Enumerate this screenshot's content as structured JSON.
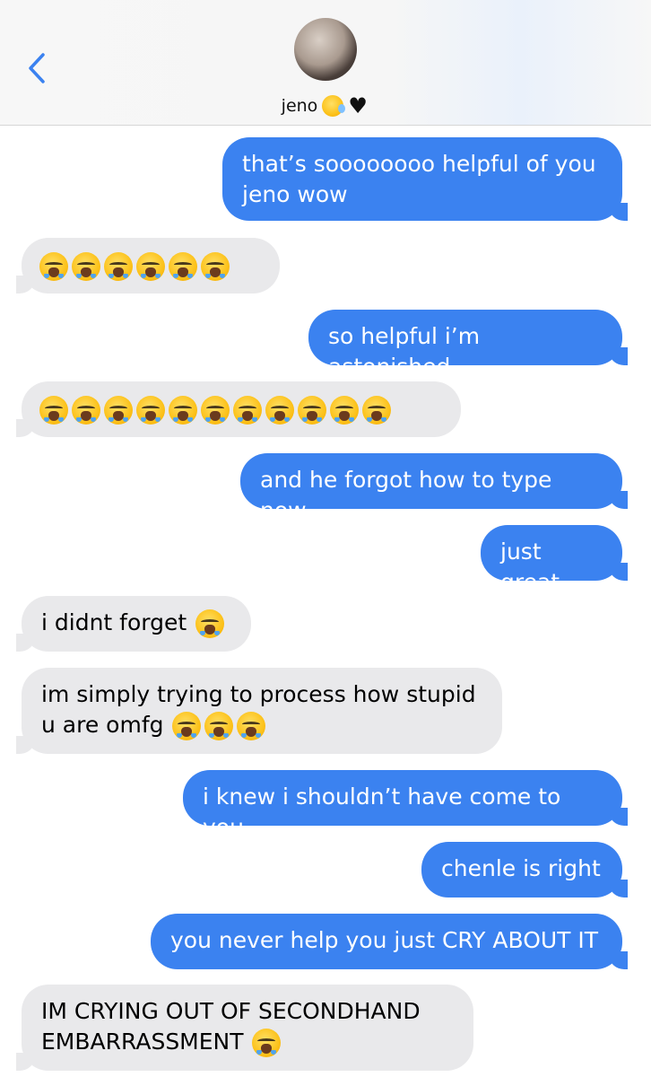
{
  "header": {
    "contact_name": "jeno",
    "emoji_1": "sleepy-face-emoji",
    "emoji_2": "black-heart-emoji"
  },
  "colors": {
    "outgoing_bubble": "#3b82f0",
    "incoming_bubble": "#e9e9eb",
    "back_chevron": "#3b82f0"
  },
  "messages": [
    {
      "direction": "out",
      "text": "that’s soooooooo helpful of you jeno wow"
    },
    {
      "direction": "in",
      "text": "",
      "emojis": 6
    },
    {
      "direction": "out",
      "text": "so helpful i’m astonished"
    },
    {
      "direction": "in",
      "text": "",
      "emojis": 11
    },
    {
      "direction": "out",
      "text": "and he forgot how to type now"
    },
    {
      "direction": "out",
      "text": "just great"
    },
    {
      "direction": "in",
      "text": "i didnt forget",
      "emojis": 1
    },
    {
      "direction": "in",
      "text": "im simply trying to process how stupid u are omfg",
      "emojis": 3
    },
    {
      "direction": "out",
      "text": "i knew i shouldn’t have come to you"
    },
    {
      "direction": "out",
      "text": "chenle is right"
    },
    {
      "direction": "out",
      "text": "you never help you just CRY ABOUT IT"
    },
    {
      "direction": "in",
      "text": "IM CRYING OUT OF SECONDHAND EMBARRASSMENT",
      "emojis": 1
    }
  ]
}
